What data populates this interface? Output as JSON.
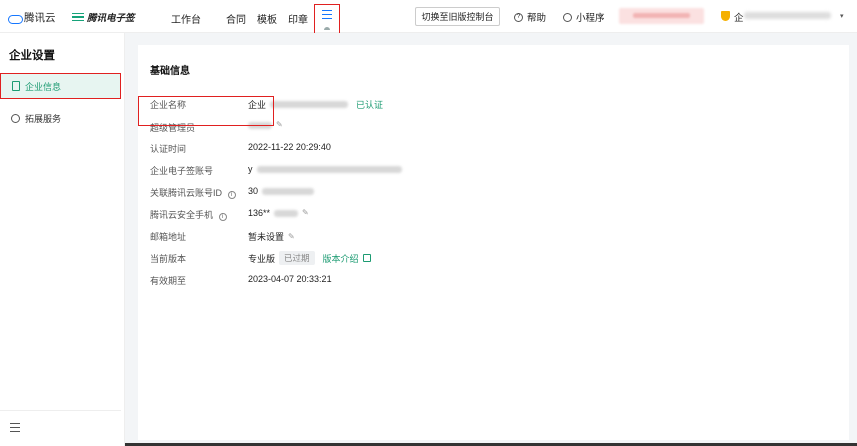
{
  "header": {
    "brand_tc": "腾讯云",
    "brand_es": "腾讯电子签",
    "nav": [
      "工作台",
      "合同",
      "模板",
      "印章"
    ],
    "switch_label": "切换至旧版控制台",
    "help_label": "帮助",
    "help_icon": "?",
    "mini_label": "小程序",
    "ent_prefix": "企",
    "caret": "▾"
  },
  "sidebar": {
    "title": "企业设置",
    "items": [
      {
        "label": "企业信息",
        "icon": "document-icon"
      },
      {
        "label": "拓展服务",
        "icon": "extension-icon"
      }
    ]
  },
  "main": {
    "card_title": "基础信息",
    "rows": {
      "name": {
        "label": "企业名称",
        "value": "企业",
        "link": "已认证"
      },
      "admin": {
        "label": "超级管理员"
      },
      "auth_time": {
        "label": "认证时间",
        "value": "2022-11-22 20:29:40"
      },
      "es_account": {
        "label": "企业电子签账号",
        "value": "y"
      },
      "tc_account": {
        "label": "关联腾讯云账号ID",
        "value": "30",
        "info": "i"
      },
      "phone": {
        "label": "腾讯云安全手机",
        "value": "136**",
        "info": "i"
      },
      "email": {
        "label": "邮箱地址",
        "value": "暂未设置"
      },
      "version": {
        "label": "当前版本",
        "value": "专业版",
        "tag": "已过期",
        "link": "版本介绍"
      },
      "expire": {
        "label": "有效期至",
        "value": "2023-04-07 20:33:21"
      }
    }
  },
  "colors": {
    "accent": "#1c9b72",
    "highlight": "#e02020",
    "brand_blue": "#1677ff"
  }
}
